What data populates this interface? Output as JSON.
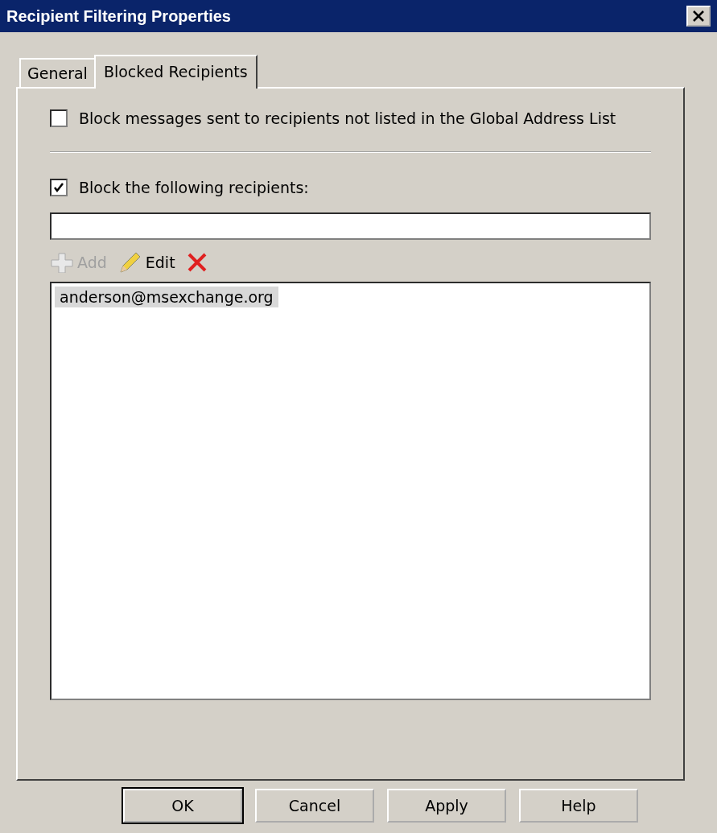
{
  "window": {
    "title": "Recipient Filtering Properties"
  },
  "tabs": [
    {
      "label": "General",
      "selected": false
    },
    {
      "label": "Blocked Recipients",
      "selected": true
    }
  ],
  "options": [
    {
      "label": "Block messages sent to recipients not listed in the Global Address List",
      "checked": false
    },
    {
      "label": "Block the following recipients:",
      "checked": true
    }
  ],
  "toolbar": [
    {
      "kind": "add",
      "label": "Add",
      "disabled": true
    },
    {
      "kind": "edit",
      "label": "Edit",
      "disabled": false
    },
    {
      "kind": "remove",
      "disabled": false
    }
  ],
  "recipients": [
    {
      "address": "anderson@msexchange.org",
      "selected": true
    }
  ],
  "buttons": [
    {
      "label": "OK",
      "default": true
    },
    {
      "label": "Cancel",
      "default": false
    },
    {
      "label": "Apply",
      "default": false
    },
    {
      "label": "Help",
      "default": false
    }
  ]
}
